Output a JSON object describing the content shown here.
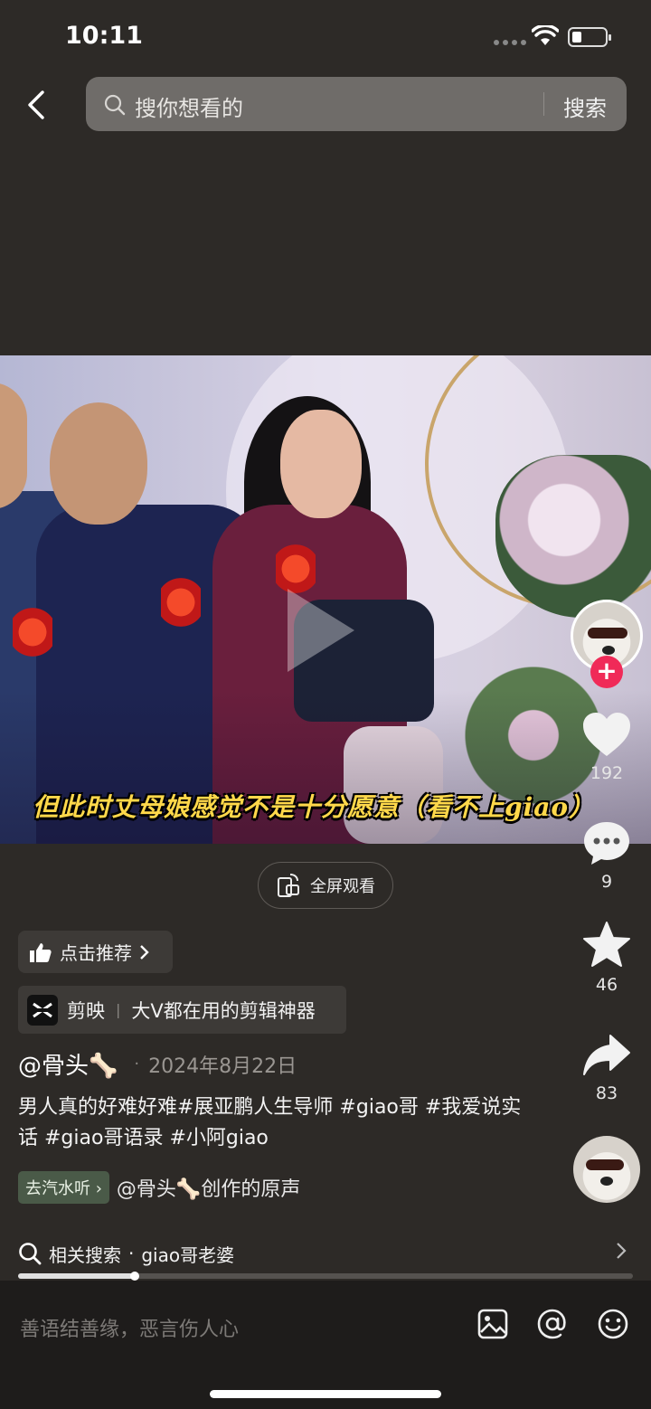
{
  "status_bar": {
    "time": "10:11"
  },
  "search": {
    "placeholder": "搜你想看的",
    "button_label": "搜索"
  },
  "video": {
    "subtitle": "但此时丈母娘感觉不是十分愿意（看不上giao）"
  },
  "actions": {
    "like_count": "192",
    "comment_count": "9",
    "favorite_count": "46",
    "share_count": "83"
  },
  "fullscreen_label": "全屏观看",
  "recommend_label": "点击推荐",
  "capcut": {
    "name": "剪映",
    "slogan": "大V都在用的剪辑神器"
  },
  "author": {
    "name": "@骨头🦴",
    "date": "2024年8月22日"
  },
  "caption": "男人真的好难好难#展亚鹏人生导师 #giao哥 #我爱说实话 #giao哥语录 #小阿giao",
  "music": {
    "tag": "去汽水听",
    "label": "@骨头🦴创作的原声"
  },
  "related_search": {
    "prefix": "相关搜索",
    "separator": "·",
    "term": "giao哥老婆"
  },
  "progress": {
    "played_fraction": 0.19
  },
  "comment_bar": {
    "placeholder": "善语结善缘，恶言伤人心"
  },
  "icons": [
    "back-icon",
    "search-icon",
    "wifi-icon",
    "battery-icon",
    "heart-icon",
    "comment-icon",
    "star-icon",
    "share-icon",
    "image-icon",
    "at-icon",
    "emoji-icon",
    "thumb-up-icon",
    "rotate-screen-icon"
  ]
}
